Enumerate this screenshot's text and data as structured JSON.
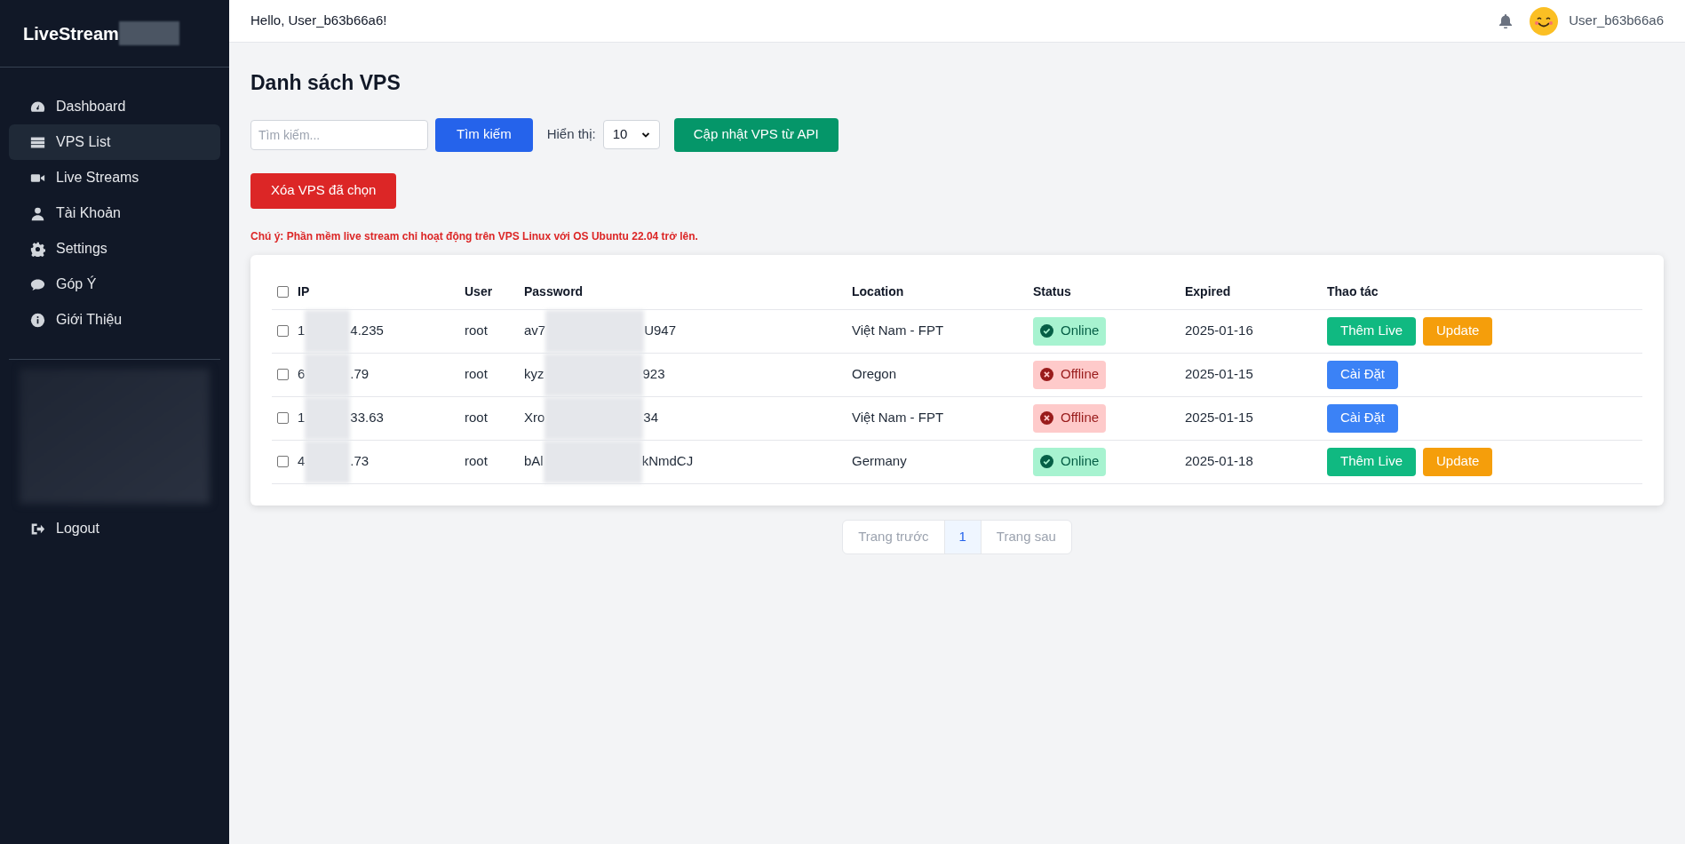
{
  "sidebar": {
    "brand": "LiveStream",
    "items": [
      {
        "label": "Dashboard",
        "selected": false
      },
      {
        "label": "VPS List",
        "selected": true
      },
      {
        "label": "Live Streams",
        "selected": false
      },
      {
        "label": "Tài Khoản",
        "selected": false
      },
      {
        "label": "Settings",
        "selected": false
      },
      {
        "label": "Góp Ý",
        "selected": false
      },
      {
        "label": "Giới Thiệu",
        "selected": false
      }
    ],
    "logout": "Logout"
  },
  "header": {
    "greeting": "Hello, User_b63b66a6!",
    "username": "User_b63b66a6"
  },
  "page": {
    "title": "Danh sách VPS",
    "search": {
      "placeholder": "Tìm kiếm...",
      "button": "Tìm kiếm"
    },
    "page_size": {
      "label": "Hiển thị:",
      "value": "10"
    },
    "sync_button": "Cập nhật VPS từ API",
    "delete_button": "Xóa VPS đã chọn",
    "notice": "Chú ý: Phần mềm live stream chỉ hoạt động trên VPS Linux với OS Ubuntu 22.04 trở lên."
  },
  "table": {
    "columns": [
      "IP",
      "User",
      "Password",
      "Location",
      "Status",
      "Expired",
      "Thao tác"
    ],
    "all_checked": false,
    "rows": [
      {
        "checked": false,
        "ip": [
          "1",
          "4.235"
        ],
        "user": "root",
        "password": [
          "av7",
          "U947"
        ],
        "location": "Việt Nam - FPT",
        "status": {
          "kind": "online",
          "label": "Online"
        },
        "expired": "2025-01-16",
        "actions": [
          {
            "kind": "add_live",
            "label": "Thêm Live"
          },
          {
            "kind": "update",
            "label": "Update"
          }
        ]
      },
      {
        "checked": false,
        "ip": [
          "6",
          ".79"
        ],
        "user": "root",
        "password": [
          "kyz",
          "923"
        ],
        "location": "Oregon",
        "status": {
          "kind": "offline",
          "label": "Offline"
        },
        "expired": "2025-01-15",
        "actions": [
          {
            "kind": "install",
            "label": "Cài Đặt"
          }
        ]
      },
      {
        "checked": false,
        "ip": [
          "1",
          "33.63"
        ],
        "user": "root",
        "password": [
          "Xro",
          "34"
        ],
        "location": "Việt Nam - FPT",
        "status": {
          "kind": "offline",
          "label": "Offline"
        },
        "expired": "2025-01-15",
        "actions": [
          {
            "kind": "install",
            "label": "Cài Đặt"
          }
        ]
      },
      {
        "checked": false,
        "ip": [
          "4",
          ".73"
        ],
        "user": "root",
        "password": [
          "bAl",
          "kNmdCJ"
        ],
        "location": "Germany",
        "status": {
          "kind": "online",
          "label": "Online"
        },
        "expired": "2025-01-18",
        "actions": [
          {
            "kind": "add_live",
            "label": "Thêm Live"
          },
          {
            "kind": "update",
            "label": "Update"
          }
        ]
      }
    ]
  },
  "pagination": {
    "previous": "Trang trước",
    "pages": [
      {
        "label": "1",
        "selected": true
      }
    ],
    "next": "Trang sau"
  }
}
